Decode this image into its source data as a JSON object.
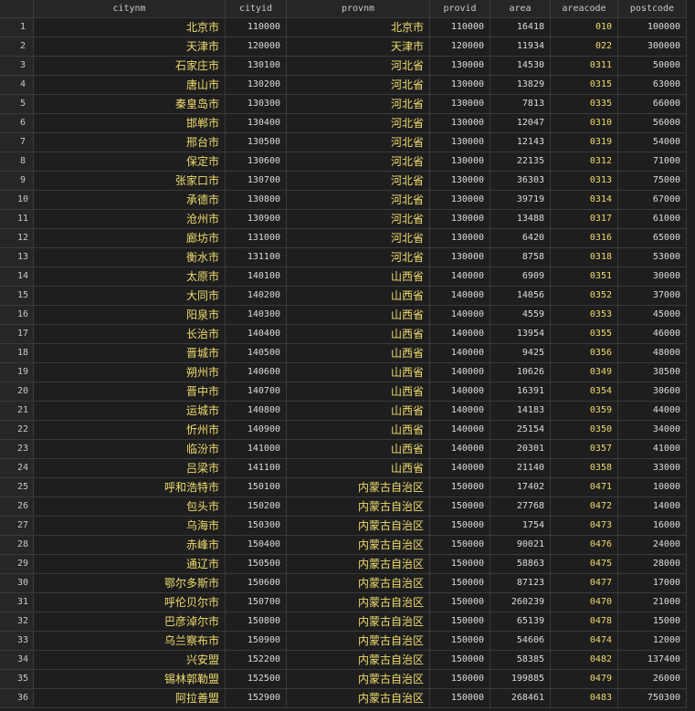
{
  "theme": {
    "background": "#1e1e1e",
    "grid_line": "#3a3a3a",
    "header_background": "#262626",
    "header_text": "#c8c8c8",
    "string_text": "#efdc6e",
    "numeric_text": "#dcdcdc"
  },
  "columns": [
    "citynm",
    "cityid",
    "provnm",
    "provid",
    "area",
    "areacode",
    "postcode"
  ],
  "rows": [
    {
      "obs": 1,
      "citynm": "北京市",
      "cityid": 110000,
      "provnm": "北京市",
      "provid": 110000,
      "area": 16418,
      "areacode": "010",
      "postcode": 100000
    },
    {
      "obs": 2,
      "citynm": "天津市",
      "cityid": 120000,
      "provnm": "天津市",
      "provid": 120000,
      "area": 11934,
      "areacode": "022",
      "postcode": 300000
    },
    {
      "obs": 3,
      "citynm": "石家庄市",
      "cityid": 130100,
      "provnm": "河北省",
      "provid": 130000,
      "area": 14530,
      "areacode": "0311",
      "postcode": 50000
    },
    {
      "obs": 4,
      "citynm": "唐山市",
      "cityid": 130200,
      "provnm": "河北省",
      "provid": 130000,
      "area": 13829,
      "areacode": "0315",
      "postcode": 63000
    },
    {
      "obs": 5,
      "citynm": "秦皇岛市",
      "cityid": 130300,
      "provnm": "河北省",
      "provid": 130000,
      "area": 7813,
      "areacode": "0335",
      "postcode": 66000
    },
    {
      "obs": 6,
      "citynm": "邯郸市",
      "cityid": 130400,
      "provnm": "河北省",
      "provid": 130000,
      "area": 12047,
      "areacode": "0310",
      "postcode": 56000
    },
    {
      "obs": 7,
      "citynm": "邢台市",
      "cityid": 130500,
      "provnm": "河北省",
      "provid": 130000,
      "area": 12143,
      "areacode": "0319",
      "postcode": 54000
    },
    {
      "obs": 8,
      "citynm": "保定市",
      "cityid": 130600,
      "provnm": "河北省",
      "provid": 130000,
      "area": 22135,
      "areacode": "0312",
      "postcode": 71000
    },
    {
      "obs": 9,
      "citynm": "张家口市",
      "cityid": 130700,
      "provnm": "河北省",
      "provid": 130000,
      "area": 36303,
      "areacode": "0313",
      "postcode": 75000
    },
    {
      "obs": 10,
      "citynm": "承德市",
      "cityid": 130800,
      "provnm": "河北省",
      "provid": 130000,
      "area": 39719,
      "areacode": "0314",
      "postcode": 67000
    },
    {
      "obs": 11,
      "citynm": "沧州市",
      "cityid": 130900,
      "provnm": "河北省",
      "provid": 130000,
      "area": 13488,
      "areacode": "0317",
      "postcode": 61000
    },
    {
      "obs": 12,
      "citynm": "廊坊市",
      "cityid": 131000,
      "provnm": "河北省",
      "provid": 130000,
      "area": 6420,
      "areacode": "0316",
      "postcode": 65000
    },
    {
      "obs": 13,
      "citynm": "衡水市",
      "cityid": 131100,
      "provnm": "河北省",
      "provid": 130000,
      "area": 8758,
      "areacode": "0318",
      "postcode": 53000
    },
    {
      "obs": 14,
      "citynm": "太原市",
      "cityid": 140100,
      "provnm": "山西省",
      "provid": 140000,
      "area": 6909,
      "areacode": "0351",
      "postcode": 30000
    },
    {
      "obs": 15,
      "citynm": "大同市",
      "cityid": 140200,
      "provnm": "山西省",
      "provid": 140000,
      "area": 14056,
      "areacode": "0352",
      "postcode": 37000
    },
    {
      "obs": 16,
      "citynm": "阳泉市",
      "cityid": 140300,
      "provnm": "山西省",
      "provid": 140000,
      "area": 4559,
      "areacode": "0353",
      "postcode": 45000
    },
    {
      "obs": 17,
      "citynm": "长治市",
      "cityid": 140400,
      "provnm": "山西省",
      "provid": 140000,
      "area": 13954,
      "areacode": "0355",
      "postcode": 46000
    },
    {
      "obs": 18,
      "citynm": "晋城市",
      "cityid": 140500,
      "provnm": "山西省",
      "provid": 140000,
      "area": 9425,
      "areacode": "0356",
      "postcode": 48000
    },
    {
      "obs": 19,
      "citynm": "朔州市",
      "cityid": 140600,
      "provnm": "山西省",
      "provid": 140000,
      "area": 10626,
      "areacode": "0349",
      "postcode": 38500
    },
    {
      "obs": 20,
      "citynm": "晋中市",
      "cityid": 140700,
      "provnm": "山西省",
      "provid": 140000,
      "area": 16391,
      "areacode": "0354",
      "postcode": 30600
    },
    {
      "obs": 21,
      "citynm": "运城市",
      "cityid": 140800,
      "provnm": "山西省",
      "provid": 140000,
      "area": 14183,
      "areacode": "0359",
      "postcode": 44000
    },
    {
      "obs": 22,
      "citynm": "忻州市",
      "cityid": 140900,
      "provnm": "山西省",
      "provid": 140000,
      "area": 25154,
      "areacode": "0350",
      "postcode": 34000
    },
    {
      "obs": 23,
      "citynm": "临汾市",
      "cityid": 141000,
      "provnm": "山西省",
      "provid": 140000,
      "area": 20301,
      "areacode": "0357",
      "postcode": 41000
    },
    {
      "obs": 24,
      "citynm": "吕梁市",
      "cityid": 141100,
      "provnm": "山西省",
      "provid": 140000,
      "area": 21140,
      "areacode": "0358",
      "postcode": 33000
    },
    {
      "obs": 25,
      "citynm": "呼和浩特市",
      "cityid": 150100,
      "provnm": "内蒙古自治区",
      "provid": 150000,
      "area": 17402,
      "areacode": "0471",
      "postcode": 10000
    },
    {
      "obs": 26,
      "citynm": "包头市",
      "cityid": 150200,
      "provnm": "内蒙古自治区",
      "provid": 150000,
      "area": 27768,
      "areacode": "0472",
      "postcode": 14000
    },
    {
      "obs": 27,
      "citynm": "乌海市",
      "cityid": 150300,
      "provnm": "内蒙古自治区",
      "provid": 150000,
      "area": 1754,
      "areacode": "0473",
      "postcode": 16000
    },
    {
      "obs": 28,
      "citynm": "赤峰市",
      "cityid": 150400,
      "provnm": "内蒙古自治区",
      "provid": 150000,
      "area": 90021,
      "areacode": "0476",
      "postcode": 24000
    },
    {
      "obs": 29,
      "citynm": "通辽市",
      "cityid": 150500,
      "provnm": "内蒙古自治区",
      "provid": 150000,
      "area": 58863,
      "areacode": "0475",
      "postcode": 28000
    },
    {
      "obs": 30,
      "citynm": "鄂尔多斯市",
      "cityid": 150600,
      "provnm": "内蒙古自治区",
      "provid": 150000,
      "area": 87123,
      "areacode": "0477",
      "postcode": 17000
    },
    {
      "obs": 31,
      "citynm": "呼伦贝尔市",
      "cityid": 150700,
      "provnm": "内蒙古自治区",
      "provid": 150000,
      "area": 260239,
      "areacode": "0470",
      "postcode": 21000
    },
    {
      "obs": 32,
      "citynm": "巴彦淖尔市",
      "cityid": 150800,
      "provnm": "内蒙古自治区",
      "provid": 150000,
      "area": 65139,
      "areacode": "0478",
      "postcode": 15000
    },
    {
      "obs": 33,
      "citynm": "乌兰察布市",
      "cityid": 150900,
      "provnm": "内蒙古自治区",
      "provid": 150000,
      "area": 54606,
      "areacode": "0474",
      "postcode": 12000
    },
    {
      "obs": 34,
      "citynm": "兴安盟",
      "cityid": 152200,
      "provnm": "内蒙古自治区",
      "provid": 150000,
      "area": 58385,
      "areacode": "0482",
      "postcode": 137400
    },
    {
      "obs": 35,
      "citynm": "锡林郭勒盟",
      "cityid": 152500,
      "provnm": "内蒙古自治区",
      "provid": 150000,
      "area": 199885,
      "areacode": "0479",
      "postcode": 26000
    },
    {
      "obs": 36,
      "citynm": "阿拉善盟",
      "cityid": 152900,
      "provnm": "内蒙古自治区",
      "provid": 150000,
      "area": 268461,
      "areacode": "0483",
      "postcode": 750300
    }
  ]
}
